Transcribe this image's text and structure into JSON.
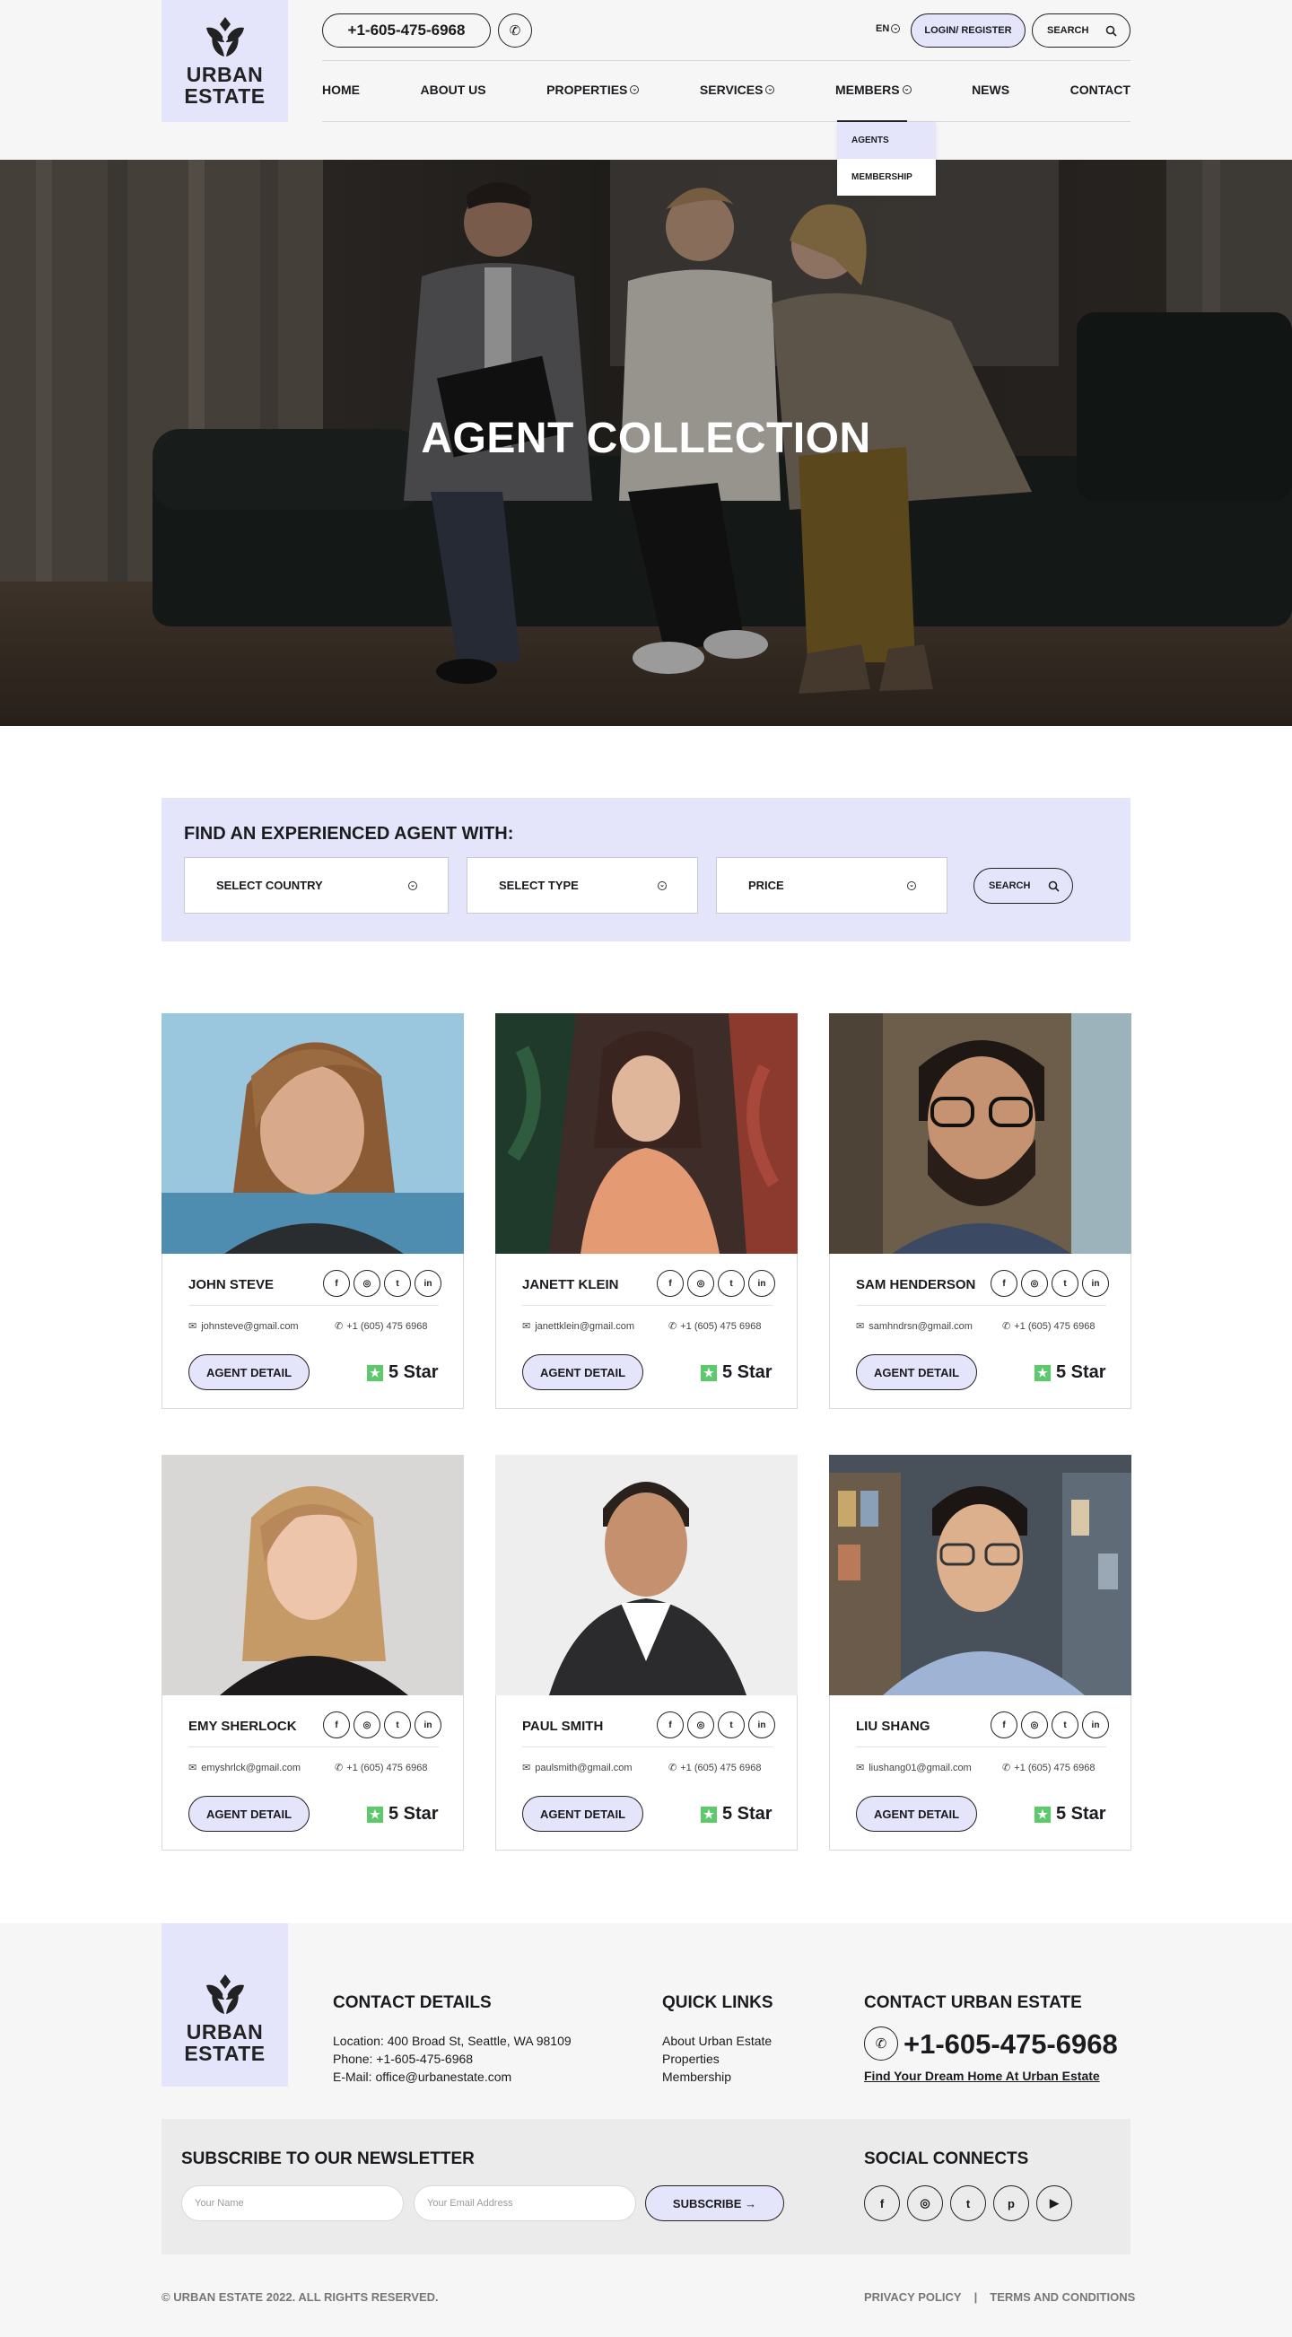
{
  "brand": {
    "logo_line1": "URBAN",
    "logo_line2": "ESTATE"
  },
  "header": {
    "phone": "+1-605-475-6968",
    "call_icon": "phone-icon",
    "language": "EN",
    "login_label": "LOGIN/ REGISTER",
    "search_label": "SEARCH"
  },
  "nav": {
    "items": [
      {
        "label": "HOME",
        "has_caret": false
      },
      {
        "label": "ABOUT US",
        "has_caret": false
      },
      {
        "label": "PROPERTIES",
        "has_caret": true
      },
      {
        "label": "SERVICES",
        "has_caret": true
      },
      {
        "label": "MEMBERS",
        "has_caret": true,
        "active": true
      },
      {
        "label": "NEWS",
        "has_caret": false
      },
      {
        "label": "CONTACT",
        "has_caret": false
      }
    ],
    "dropdown": [
      "AGENTS",
      "MEMBERSHIP"
    ]
  },
  "hero": {
    "title": "AGENT COLLECTION"
  },
  "finder": {
    "title": "FIND AN EXPERIENCED AGENT WITH:",
    "selects": [
      "SELECT COUNTRY",
      "SELECT TYPE",
      "PRICE"
    ],
    "search_label": "SEARCH"
  },
  "agents": [
    {
      "name": "JOHN STEVE",
      "email": "johnsteve@gmail.com",
      "phone": "+1 (605) 475 6968",
      "button": "AGENT DETAIL",
      "rating": "5 Star"
    },
    {
      "name": "JANETT KLEIN",
      "email": "janettklein@gmail.com",
      "phone": "+1 (605) 475 6968",
      "button": "AGENT DETAIL",
      "rating": "5 Star"
    },
    {
      "name": "SAM HENDERSON",
      "email": "samhndrsn@gmail.com",
      "phone": "+1 (605) 475 6968",
      "button": "AGENT DETAIL",
      "rating": "5 Star"
    },
    {
      "name": "EMY SHERLOCK",
      "email": "emyshrlck@gmail.com",
      "phone": "+1 (605) 475 6968",
      "button": "AGENT DETAIL",
      "rating": "5 Star"
    },
    {
      "name": "PAUL SMITH",
      "email": "paulsmith@gmail.com",
      "phone": "+1 (605) 475 6968",
      "button": "AGENT DETAIL",
      "rating": "5 Star"
    },
    {
      "name": "LIU SHANG",
      "email": "liushang01@gmail.com",
      "phone": "+1 (605) 475 6968",
      "button": "AGENT DETAIL",
      "rating": "5 Star"
    }
  ],
  "social_icons": [
    "f",
    "◎",
    "t",
    "in"
  ],
  "footer": {
    "contact_title": "CONTACT DETAILS",
    "location": "Location: 400 Broad St, Seattle, WA 98109",
    "phone": "Phone: +1-605-475-6968",
    "email": "E-Mail: office@urbanestate.com",
    "quick_title": "QUICK LINKS",
    "quick_links": [
      "About Urban Estate",
      "Properties",
      "Membership"
    ],
    "contact_ue_title": "CONTACT URBAN ESTATE",
    "big_phone": "+1-605-475-6968",
    "dream_link": "Find Your Dream Home At Urban Estate",
    "newsletter_title": "SUBSCRIBE TO OUR NEWSLETTER",
    "name_placeholder": "Your Name",
    "email_placeholder": "Your Email Address",
    "subscribe_label": "SUBSCRIBE →",
    "social_title": "SOCIAL CONNECTS",
    "social": [
      "f",
      "◎",
      "t",
      "p",
      "▶"
    ],
    "copyright": "© URBAN ESTATE 2022. ALL RIGHTS RESERVED.",
    "privacy": "PRIVACY POLICY",
    "separator": "|",
    "terms": "TERMS AND CONDITIONS"
  },
  "colors": {
    "accent": "#e4e4fa",
    "star": "#5cc96b",
    "dark": "#1b1b1f"
  }
}
